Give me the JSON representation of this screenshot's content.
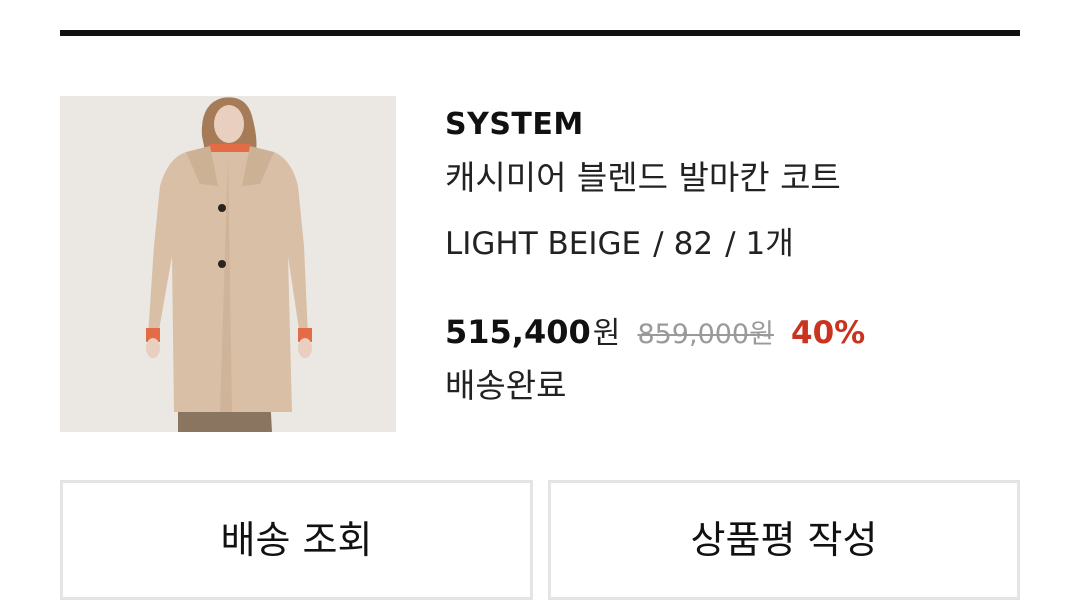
{
  "order_item": {
    "brand": "SYSTEM",
    "product_name": "캐시미어 블렌드 발마칸 코트",
    "options": {
      "color": "LIGHT BEIGE",
      "size": "82",
      "quantity": "1개",
      "separator": "/"
    },
    "price": {
      "sale_amount": "515,400",
      "original_amount": "859,000",
      "currency_unit": "원",
      "discount_rate": "40%"
    },
    "status": "배송완료",
    "image_icon": "coat-product-photo"
  },
  "actions": {
    "track_delivery_label": "배송 조회",
    "write_review_label": "상품평 작성"
  },
  "colors": {
    "discount": "#c9331f",
    "original_price": "#9a9a9a",
    "divider": "#111111",
    "button_border": "#e4e4e4"
  }
}
